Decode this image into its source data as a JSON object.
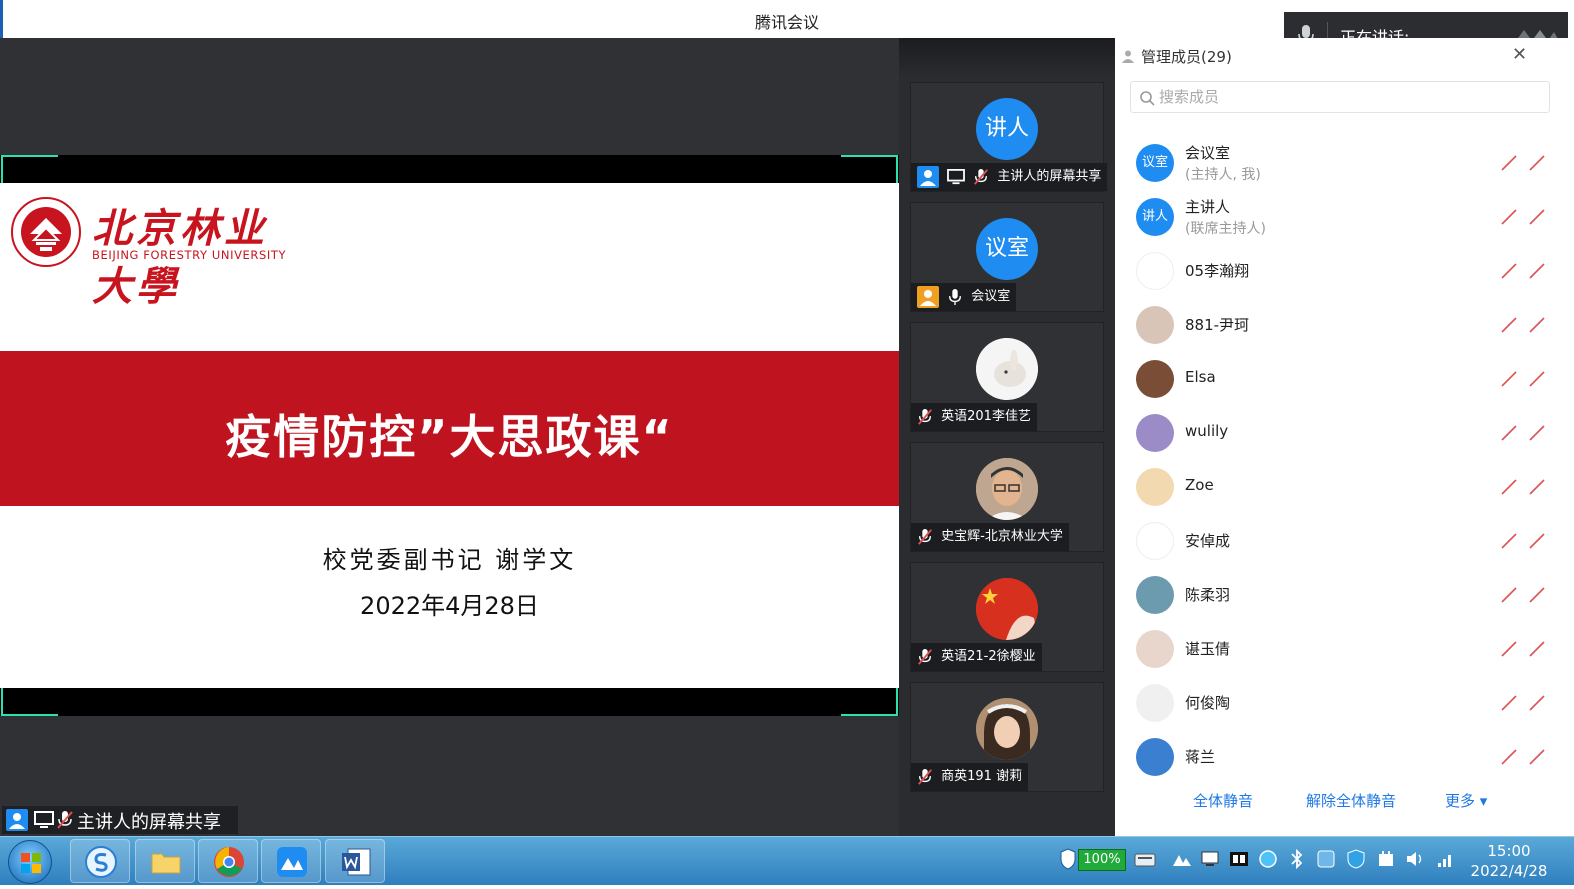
{
  "window": {
    "title": "腾讯会议"
  },
  "speaking": {
    "label": "正在讲话:"
  },
  "slide": {
    "university_cn": "北京林业大學",
    "university_en": "BEIJING FORESTRY UNIVERSITY",
    "title": "疫情防控”大思政课“",
    "presenter": "校党委副书记  谢学文",
    "date": "2022年4月28日"
  },
  "share_label": "主讲人的屏幕共享",
  "video_tiles": [
    {
      "avatar_text": "讲人",
      "name": "主讲人的屏幕共享",
      "avatar_color": "#1e8cf0"
    },
    {
      "avatar_text": "议室",
      "name": "会议室",
      "avatar_color": "#1e8cf0"
    },
    {
      "avatar_text": "",
      "name": "英语201李佳艺",
      "avatar_color": "#f2f2f2"
    },
    {
      "avatar_text": "",
      "name": "史宝辉-北京林业大学",
      "avatar_color": "#c9a788"
    },
    {
      "avatar_text": "",
      "name": "英语21-2徐樱业",
      "avatar_color": "#d8301e"
    },
    {
      "avatar_text": "",
      "name": "商英191 谢莉",
      "avatar_color": "#8a6a52"
    }
  ],
  "panel": {
    "title": "管理成员(29)",
    "search_placeholder": "搜索成员",
    "members": [
      {
        "avatar_text": "议室",
        "name": "会议室",
        "sub": "(主持人, 我)",
        "avatar_color": "#1e8cf0"
      },
      {
        "avatar_text": "讲人",
        "name": "主讲人",
        "sub": "(联席主持人)",
        "avatar_color": "#1e8cf0"
      },
      {
        "avatar_text": "",
        "name": "05李瀚翔",
        "sub": "",
        "avatar_color": "#ffffff"
      },
      {
        "avatar_text": "",
        "name": "881-尹珂",
        "sub": "",
        "avatar_color": "#d9c4b8"
      },
      {
        "avatar_text": "",
        "name": "Elsa",
        "sub": "",
        "avatar_color": "#7a4d36"
      },
      {
        "avatar_text": "",
        "name": "wulily",
        "sub": "",
        "avatar_color": "#9b8cc8"
      },
      {
        "avatar_text": "",
        "name": "Zoe",
        "sub": "",
        "avatar_color": "#f3d9b0"
      },
      {
        "avatar_text": "",
        "name": "安倬成",
        "sub": "",
        "avatar_color": "#ffffff"
      },
      {
        "avatar_text": "",
        "name": "陈柔羽",
        "sub": "",
        "avatar_color": "#6c9bb0"
      },
      {
        "avatar_text": "",
        "name": "谌玉倩",
        "sub": "",
        "avatar_color": "#e8d6cc"
      },
      {
        "avatar_text": "",
        "name": "何俊陶",
        "sub": "",
        "avatar_color": "#f0f0f0"
      },
      {
        "avatar_text": "",
        "name": "蒋兰",
        "sub": "",
        "avatar_color": "#3b7fd0"
      }
    ],
    "footer": {
      "mute_all": "全体静音",
      "unmute_all": "解除全体静音",
      "more": "更多 ▾"
    }
  },
  "taskbar": {
    "battery": "100%",
    "time": "15:00",
    "date": "2022/4/28"
  },
  "colors": {
    "accent": "#1e8cf0",
    "slide_red": "#c01320",
    "mute_red": "#e05050"
  }
}
